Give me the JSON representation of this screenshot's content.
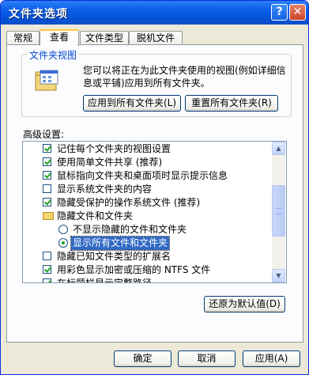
{
  "window": {
    "title": "文件夹选项"
  },
  "titlebar": {
    "help_glyph": "?",
    "close_glyph": "✕"
  },
  "tabs": [
    "常规",
    "查看",
    "文件类型",
    "脱机文件"
  ],
  "active_tab": "查看",
  "folder_views": {
    "legend": "文件夹视图",
    "description": "您可以将正在为此文件夹使用的视图(例如详细信息或平铺)应用到所有文件夹。",
    "apply_button": "应用到所有文件夹(L)",
    "reset_button": "重置所有文件夹(R)"
  },
  "advanced": {
    "label": "高级设置:",
    "items": [
      {
        "type": "checkbox",
        "checked": true,
        "label": "记住每个文件夹的视图设置"
      },
      {
        "type": "checkbox",
        "checked": true,
        "label": "使用简单文件共享 (推荐)"
      },
      {
        "type": "checkbox",
        "checked": true,
        "label": "鼠标指向文件夹和桌面项时显示提示信息"
      },
      {
        "type": "checkbox",
        "checked": false,
        "label": "显示系统文件夹的内容"
      },
      {
        "type": "checkbox",
        "checked": true,
        "label": "隐藏受保护的操作系统文件 (推荐)"
      },
      {
        "type": "folder",
        "label": "隐藏文件和文件夹"
      },
      {
        "type": "radio",
        "checked": false,
        "label": "不显示隐藏的文件和文件夹"
      },
      {
        "type": "radio",
        "checked": true,
        "label": "显示所有文件和文件夹"
      },
      {
        "type": "checkbox",
        "checked": false,
        "label": "隐藏已知文件类型的扩展名"
      },
      {
        "type": "checkbox",
        "checked": true,
        "label": "用彩色显示加密或压缩的 NTFS 文件"
      },
      {
        "type": "checkbox",
        "checked": true,
        "label": "在标题栏显示完整路径"
      }
    ],
    "scroll_up_glyph": "▲",
    "scroll_down_glyph": "▼",
    "restore_button": "还原为默认值(D)"
  },
  "footer": {
    "ok": "确定",
    "cancel": "取消",
    "apply": "应用(A)"
  }
}
